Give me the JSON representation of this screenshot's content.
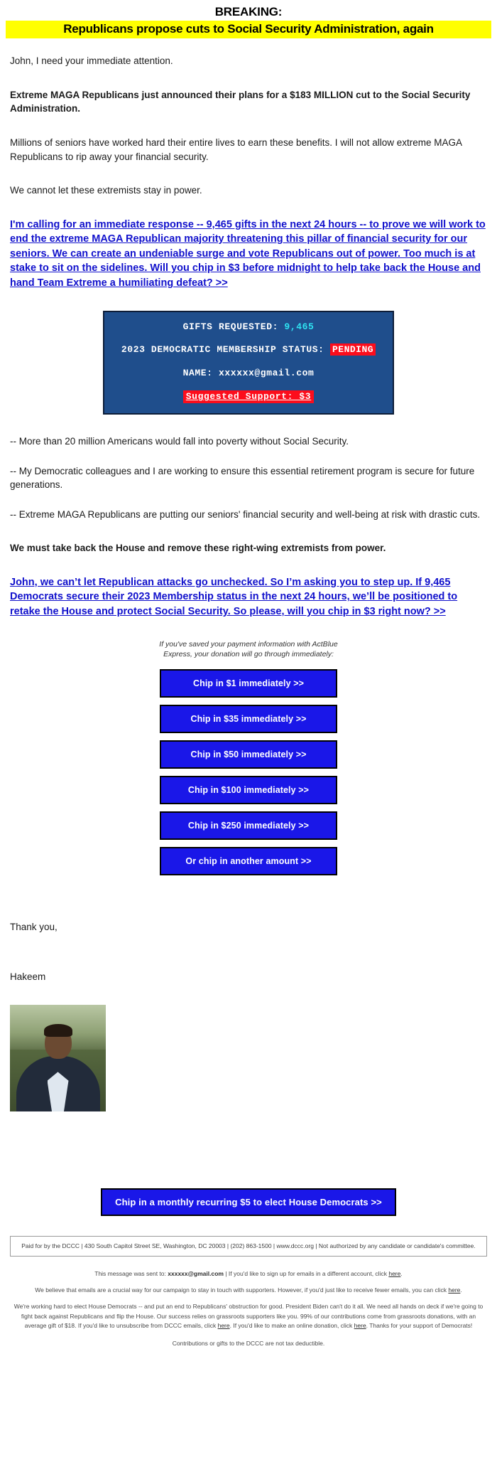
{
  "header": {
    "breaking_label": "BREAKING:",
    "highlight_headline": "Republicans propose cuts to Social Security Administration, again"
  },
  "body": {
    "greeting": "John, I need your immediate attention.",
    "bold_lede": "Extreme MAGA Republicans just announced their plans for a $183 MILLION cut to the Social Security Administration.",
    "para_seniors": "Millions of seniors have worked hard their entire lives to earn these benefits. I will not allow extreme MAGA Republicans to rip away your financial security.",
    "para_extremists": "We cannot let these extremists stay in power.",
    "ask_link_1": "I'm calling for an immediate response -- 9,465 gifts in the next 24 hours -- to prove we will work to end the extreme MAGA Republican majority threatening this pillar of financial security for our seniors. We can create an undeniable surge and vote Republicans out of power. Too much is at stake to sit on the sidelines. Will you chip in $3 before midnight to help take back the House and hand Team Extreme a humiliating defeat? >>",
    "bullet_1": "-- More than 20 million Americans would fall into poverty without Social Security.",
    "bullet_2": "-- My Democratic colleagues and I are working to ensure this essential retirement program is secure for future generations.",
    "bullet_3": "-- Extreme MAGA Republicans are putting our seniors' financial security and well-being at risk with drastic cuts.",
    "bold_takeback": "We must take back the House and remove these right-wing extremists from power.",
    "ask_link_2": "John, we can’t let Republican attacks go unchecked. So I’m asking you to step up. If 9,465 Democrats secure their 2023 Membership status in the next 24 hours, we’ll be positioned to retake the House and protect Social Security. So please, will you chip in $3 right now? >>",
    "thank_you": "Thank you,",
    "signature_name": "Hakeem"
  },
  "status_box": {
    "gifts_label": "GIFTS REQUESTED:",
    "gifts_value": "9,465",
    "membership_label": "2023 DEMOCRATIC MEMBERSHIP STATUS:",
    "membership_status": "PENDING",
    "name_label": "NAME:",
    "name_value": "xxxxxx@gmail.com",
    "suggested_support": "Suggested Support: $3",
    "background_color": "#1f4e8c",
    "accent_cyan": "#2fe3f2",
    "accent_red": "#fc0d1c"
  },
  "express_note": {
    "line1": "If you've saved your payment information with ActBlue",
    "line2": "Express, your donation will go through immediately:"
  },
  "donate_buttons": [
    {
      "label": "Chip in $1 immediately >>"
    },
    {
      "label": "Chip in $35 immediately >>"
    },
    {
      "label": "Chip in $50 immediately >>"
    },
    {
      "label": "Chip in $100 immediately >>"
    },
    {
      "label": "Chip in $250 immediately >>"
    },
    {
      "label": "Or chip in another amount >>"
    }
  ],
  "recurring_button": {
    "label": "Chip in a monthly recurring $5 to elect House Democrats >>"
  },
  "footer": {
    "paid_for": "Paid for by the DCCC | 430 South Capitol Street SE, Washington, DC 20003 | (202) 863-1500 | www.dccc.org | Not authorized by any candidate or candidate's committee.",
    "sent_to_prefix": "This message was sent to:",
    "sent_to_email": "xxxxxx@gmail.com",
    "sent_to_suffix": "| If you'd like to sign up for emails in a different account, click",
    "here": "here",
    "period": ".",
    "fewer_emails": "We believe that emails are a crucial way for our campaign to stay in touch with supporters. However, if you'd just like to receive fewer emails, you can click",
    "long_block_a": "We're working hard to elect House Democrats -- and put an end to Republicans' obstruction for good. President Biden can't do it all. We need all hands on deck if we're going to fight back against Republicans and flip the House. Our success relies on grassroots supporters like you. 99% of our contributions come from grassroots donations, with an average gift of $18. If you'd like to unsubscribe from DCCC emails, click",
    "long_block_b": ". If you'd like to make an online donation, click",
    "long_block_c": ". Thanks for your support of Democrats!",
    "tax_note": "Contributions or gifts to the DCCC are not tax deductible."
  },
  "colors": {
    "link_blue": "#1111cc",
    "button_blue": "#1a17e8",
    "highlight_yellow": "#ffff00"
  }
}
